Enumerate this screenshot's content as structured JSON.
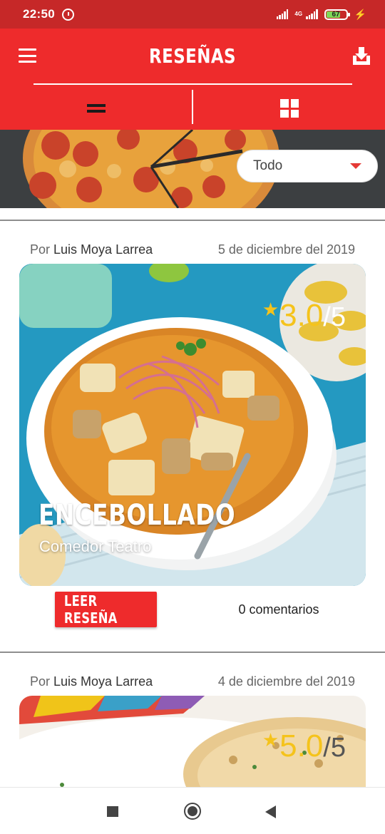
{
  "status": {
    "time": "22:50",
    "network": "4G",
    "battery": "67"
  },
  "header": {
    "title": "RESEÑAS"
  },
  "filter": {
    "selected": "Todo"
  },
  "reviews": [
    {
      "author_prefix": "Por",
      "author": "Luis Moya Larrea",
      "date": "5 de diciembre del 2019",
      "score": "3.0",
      "out_of": "/5",
      "dish": "ENCEBOLLADO",
      "restaurant": "Comedor Teatro",
      "read_label": "LEER RESEÑA",
      "comments": "0 comentarios"
    },
    {
      "author_prefix": "Por",
      "author": "Luis Moya Larrea",
      "date": "4 de diciembre del 2019",
      "score": "5.0",
      "out_of": "/5"
    }
  ],
  "icons": {
    "menu": "menu-icon",
    "download": "download-icon",
    "list_view": "list-view-icon",
    "grid_view": "grid-view-icon",
    "star": "star-icon",
    "dropdown": "chevron-down-icon"
  },
  "colors": {
    "brand_red": "#ee2b2c",
    "status_red": "#c62828",
    "star_gold": "#f5c31b"
  }
}
